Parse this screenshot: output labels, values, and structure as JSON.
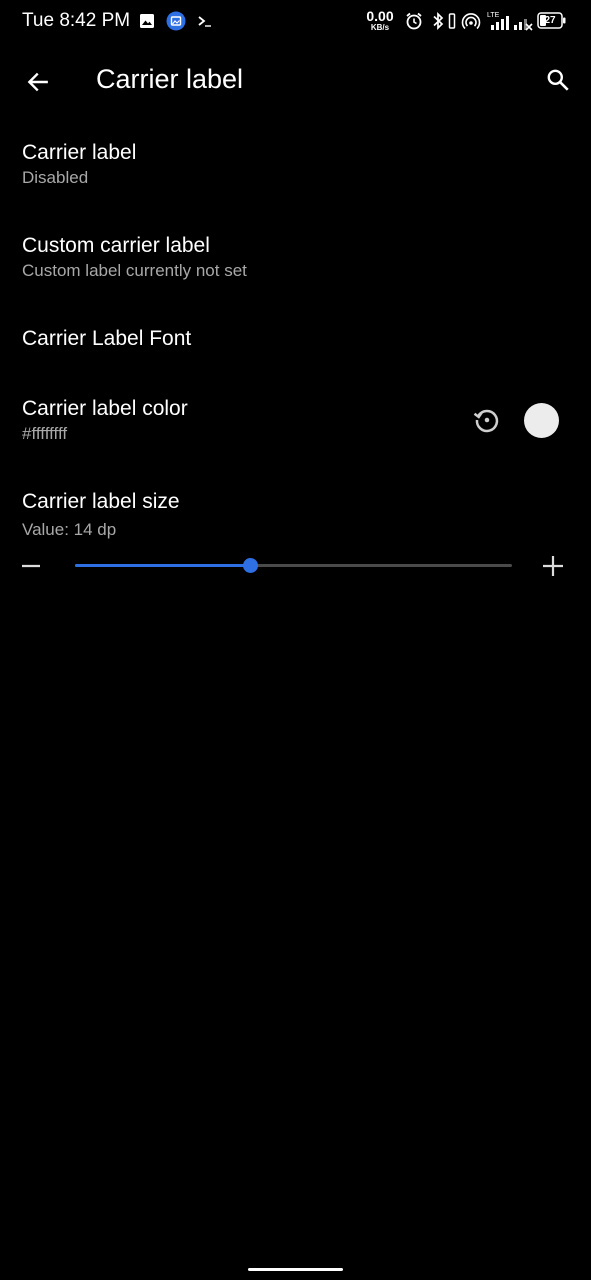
{
  "status_bar": {
    "time": "Tue 8:42 PM",
    "net_speed_value": "0.00",
    "net_speed_unit": "KB/s",
    "network_type": "LTE",
    "battery_level": "27",
    "icons": [
      "image-icon",
      "gallery-app-icon",
      "terminal-icon",
      "speed-indicator",
      "alarm-icon",
      "bluetooth-icon",
      "vibrate-icon",
      "hotspot-icon",
      "signal-icon",
      "signal-no-data-icon",
      "battery-icon"
    ]
  },
  "app_bar": {
    "title": "Carrier label",
    "back_icon": "arrow-back-icon",
    "search_icon": "search-icon"
  },
  "preferences": [
    {
      "title": "Carrier label",
      "summary": "Disabled"
    },
    {
      "title": "Custom carrier label",
      "summary": "Custom label currently not set"
    },
    {
      "title": "Carrier Label Font",
      "summary": ""
    },
    {
      "title": "Carrier label color",
      "summary": "#ffffffff",
      "reset_icon": "reset-icon",
      "swatch_color": "#ececec"
    },
    {
      "title": "Carrier label size",
      "summary": "Value: 14 dp"
    }
  ],
  "slider": {
    "decrease_icon": "minus-icon",
    "increase_icon": "plus-icon",
    "fraction": 0.4,
    "accent_color": "#2f6fe4"
  }
}
